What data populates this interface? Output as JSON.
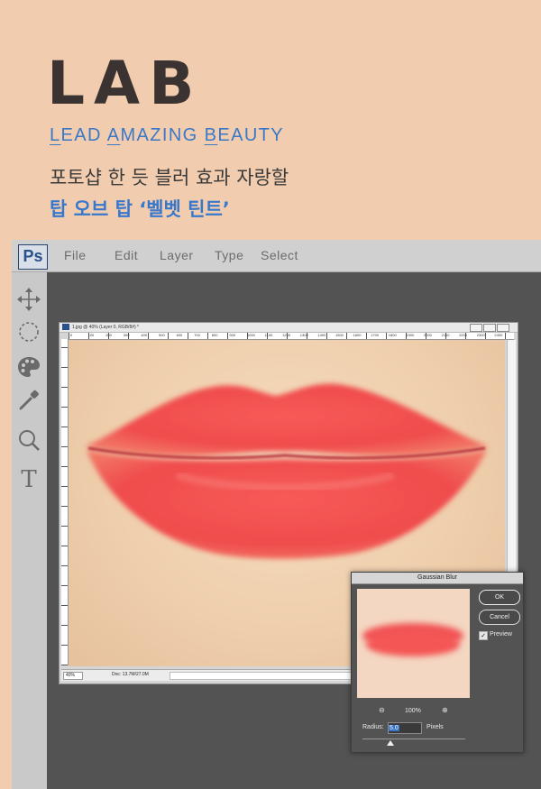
{
  "hero": {
    "logo": "LAB",
    "tagline": {
      "l1": "L",
      "w1": "EAD ",
      "l2": "A",
      "w2": "MAZING ",
      "l3": "B",
      "w3": "EAUTY"
    },
    "headline": "포토샵 한 듯 블러 효과 자랑할",
    "subheadline": "탑 오브 탑 ‘벨벳 틴트’"
  },
  "app": {
    "logo": "Ps",
    "menu": [
      "File",
      "Edit",
      "Layer",
      "Type",
      "Select"
    ]
  },
  "document": {
    "title": "1.jpg @ 40% (Layer 0, RGB/8#) *",
    "ruler_ticks": [
      "0",
      "100",
      "200",
      "300",
      "400",
      "500",
      "600",
      "700",
      "800",
      "900",
      "1000",
      "1100",
      "1200",
      "1300",
      "1400",
      "1500",
      "1600",
      "1700",
      "1800",
      "1900",
      "2000",
      "2100",
      "2200",
      "2300",
      "2400"
    ],
    "zoom": "40%",
    "doc_size": "Doc: 13.7M/27.0M"
  },
  "dialog": {
    "title": "Gaussian Blur",
    "ok_label": "OK",
    "cancel_label": "Cancel",
    "preview_label": "Preview",
    "preview_checked": true,
    "zoom_percent": "100%",
    "radius_label": "Radius:",
    "radius_value": "5.0",
    "radius_unit": "Pixels",
    "radius_slider_fraction": 0.27
  },
  "colors": {
    "background": "#f2ccae",
    "accent_blue": "#3a78c8",
    "lip_red": "#f2504f",
    "ps_workspace": "#535353"
  },
  "icons": [
    "move-icon",
    "lasso-icon",
    "palette-icon",
    "eyedropper-icon",
    "zoom-icon",
    "type-icon",
    "zoom-out-icon",
    "zoom-in-icon",
    "check-icon"
  ]
}
